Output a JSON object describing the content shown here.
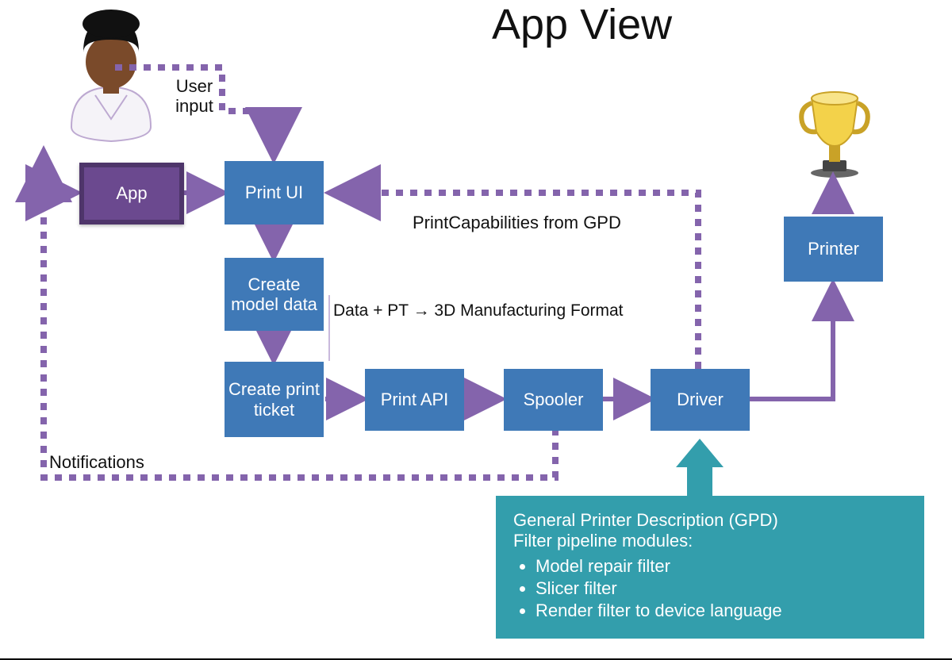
{
  "title": "App View",
  "boxes": {
    "app": "App",
    "print_ui": "Print UI",
    "create_model": "Create model data",
    "create_ticket": "Create print ticket",
    "print_api": "Print API",
    "spooler": "Spooler",
    "driver": "Driver",
    "printer": "Printer"
  },
  "labels": {
    "user_input": "User input",
    "print_caps": "PrintCapabilities from GPD",
    "data_pt": "Data + PT → 3D Manufacturing  Format",
    "notifications": "Notifications"
  },
  "callout": {
    "line1": "General Printer Description (GPD)",
    "line2": "Filter pipeline modules:",
    "bullets": [
      "Model repair filter",
      "Slicer filter",
      "Render filter to device language"
    ]
  }
}
